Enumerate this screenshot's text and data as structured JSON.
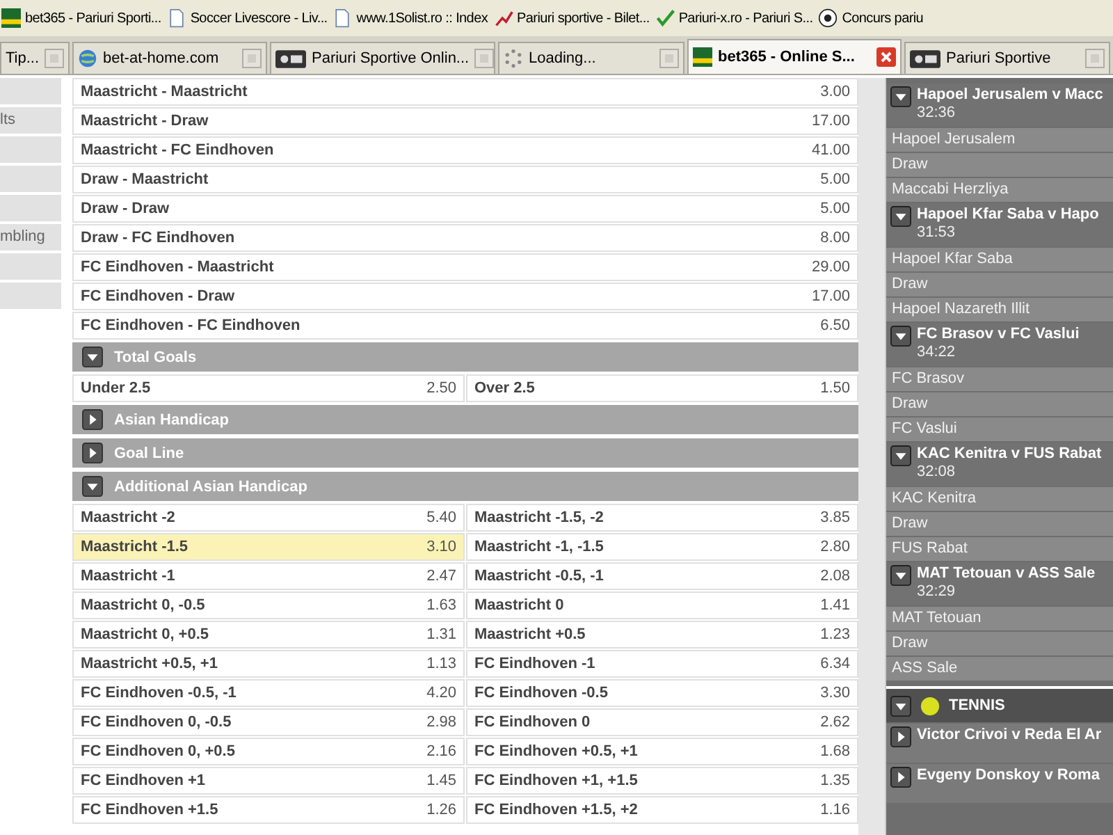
{
  "bookmarks": [
    {
      "kind": "logo",
      "label": "bet365 - Pariuri Sporti..."
    },
    {
      "kind": "page",
      "label": "Soccer Livescore - Liv..."
    },
    {
      "kind": "page",
      "label": "www.1Solist.ro :: Index"
    },
    {
      "kind": "chart",
      "label": "Pariuri sportive - Bilet..."
    },
    {
      "kind": "check",
      "label": "Pariuri-x.ro - Pariuri S..."
    },
    {
      "kind": "ball",
      "label": "Concurs pariu"
    }
  ],
  "tabs": [
    {
      "kind": "none",
      "label": "Tip...",
      "selected": false
    },
    {
      "kind": "globe",
      "label": "bet-at-home.com",
      "selected": false
    },
    {
      "kind": "logo",
      "label": "Pariuri Sportive Onlin...",
      "selected": false
    },
    {
      "kind": "loading",
      "label": "Loading...",
      "selected": false
    },
    {
      "kind": "bet",
      "label": "bet365 - Online S...",
      "selected": true
    },
    {
      "kind": "logo",
      "label": "Pariuri Sportive",
      "selected": false
    }
  ],
  "sidebar": {
    "items": [
      {
        "kind": "blank"
      },
      {
        "kind": "text",
        "label": "lts"
      },
      {
        "kind": "blank"
      },
      {
        "kind": "blank"
      },
      {
        "kind": "blank"
      },
      {
        "kind": "text",
        "label": "mbling"
      },
      {
        "kind": "blank"
      },
      {
        "kind": "blank"
      }
    ]
  },
  "markets": [
    {
      "kind": "list",
      "rows": [
        {
          "name": "Maastricht - Maastricht",
          "odds": "3.00"
        },
        {
          "name": "Maastricht - Draw",
          "odds": "17.00"
        },
        {
          "name": "Maastricht - FC Eindhoven",
          "odds": "41.00"
        },
        {
          "name": "Draw - Maastricht",
          "odds": "5.00"
        },
        {
          "name": "Draw - Draw",
          "odds": "5.00"
        },
        {
          "name": "Draw - FC Eindhoven",
          "odds": "8.00"
        },
        {
          "name": "FC Eindhoven - Maastricht",
          "odds": "29.00"
        },
        {
          "name": "FC Eindhoven - Draw",
          "odds": "17.00"
        },
        {
          "name": "FC Eindhoven - FC Eindhoven",
          "odds": "6.50"
        }
      ]
    },
    {
      "kind": "grid",
      "title": "Total Goals",
      "expanded": true,
      "rows": [
        {
          "name": "Under 2.5",
          "odds": "2.50",
          "selected": false
        },
        {
          "name": "Over 2.5",
          "odds": "1.50",
          "selected": false
        }
      ]
    },
    {
      "title": "Asian Handicap",
      "expanded": false
    },
    {
      "title": "Goal Line",
      "expanded": false
    },
    {
      "kind": "grid",
      "title": "Additional Asian Handicap",
      "expanded": true,
      "rows": [
        {
          "name": "Maastricht -2",
          "odds": "5.40",
          "selected": false
        },
        {
          "name": "Maastricht -1.5, -2",
          "odds": "3.85",
          "selected": false
        },
        {
          "name": "Maastricht -1.5",
          "odds": "3.10",
          "selected": true
        },
        {
          "name": "Maastricht -1, -1.5",
          "odds": "2.80",
          "selected": false
        },
        {
          "name": "Maastricht -1",
          "odds": "2.47",
          "selected": false
        },
        {
          "name": "Maastricht -0.5, -1",
          "odds": "2.08",
          "selected": false
        },
        {
          "name": "Maastricht 0, -0.5",
          "odds": "1.63",
          "selected": false
        },
        {
          "name": "Maastricht 0",
          "odds": "1.41",
          "selected": false
        },
        {
          "name": "Maastricht 0, +0.5",
          "odds": "1.31",
          "selected": false
        },
        {
          "name": "Maastricht +0.5",
          "odds": "1.23",
          "selected": false
        },
        {
          "name": "Maastricht +0.5, +1",
          "odds": "1.13",
          "selected": false
        },
        {
          "name": "FC Eindhoven -1",
          "odds": "6.34",
          "selected": false
        },
        {
          "name": "FC Eindhoven -0.5, -1",
          "odds": "4.20",
          "selected": false
        },
        {
          "name": "FC Eindhoven -0.5",
          "odds": "3.30",
          "selected": false
        },
        {
          "name": "FC Eindhoven 0, -0.5",
          "odds": "2.98",
          "selected": false
        },
        {
          "name": "FC Eindhoven 0",
          "odds": "2.62",
          "selected": false
        },
        {
          "name": "FC Eindhoven 0, +0.5",
          "odds": "2.16",
          "selected": false
        },
        {
          "name": "FC Eindhoven +0.5, +1",
          "odds": "1.68",
          "selected": false
        },
        {
          "name": "FC Eindhoven +1",
          "odds": "1.45",
          "selected": false
        },
        {
          "name": "FC Eindhoven +1, +1.5",
          "odds": "1.35",
          "selected": false
        },
        {
          "name": "FC Eindhoven +1.5",
          "odds": "1.26",
          "selected": false
        },
        {
          "name": "FC Eindhoven +1.5, +2",
          "odds": "1.16",
          "selected": false
        }
      ]
    }
  ],
  "in_play": [
    {
      "kind": "event",
      "title": "Hapoel Jerusalem v Macc",
      "time": "32:36",
      "expanded": true,
      "selections": [
        "Hapoel Jerusalem",
        "Draw",
        "Maccabi Herzliya"
      ]
    },
    {
      "kind": "event",
      "title": "Hapoel Kfar Saba v Hapo",
      "time": "31:53",
      "expanded": true,
      "selections": [
        "Hapoel Kfar Saba",
        "Draw",
        "Hapoel Nazareth Illit"
      ]
    },
    {
      "kind": "event",
      "title": "FC Brasov v FC Vaslui",
      "time": "34:22",
      "expanded": true,
      "selections": [
        "FC Brasov",
        "Draw",
        "FC Vaslui"
      ]
    },
    {
      "kind": "event",
      "title": "KAC Kenitra v FUS Rabat",
      "time": "32:08",
      "expanded": true,
      "selections": [
        "KAC Kenitra",
        "Draw",
        "FUS Rabat"
      ]
    },
    {
      "kind": "event",
      "title": "MAT Tetouan v ASS Sale",
      "time": "32:29",
      "expanded": true,
      "selections": [
        "MAT Tetouan",
        "Draw",
        "ASS Sale"
      ]
    },
    {
      "kind": "sport",
      "title": "TENNIS",
      "expanded": true
    },
    {
      "kind": "event",
      "title": "Victor Crivoi v Reda El Ar",
      "expanded": false
    },
    {
      "kind": "event",
      "title": "Evgeny Donskoy v Roma",
      "expanded": false
    }
  ]
}
